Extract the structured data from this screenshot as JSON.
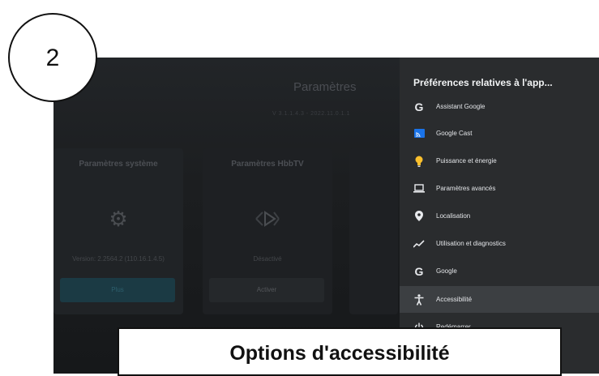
{
  "step_badge": "2",
  "caption": "Options d'accessibilité",
  "background": {
    "title": "Paramètres",
    "version": "V 3.1.1.4.3 - 2022.11.0.1.1",
    "cards": [
      {
        "title": "Paramètres système",
        "icon": "gear-icon",
        "subtitle": "Version: 2.2564.2 (110.16.1.4.5)",
        "button": "Plus"
      },
      {
        "title": "Paramètres HbbTV",
        "icon": "play-icon",
        "subtitle": "Désactivé",
        "button": "Activer"
      }
    ]
  },
  "panel": {
    "title": "Préférences relatives à l'app...",
    "items": [
      {
        "label": "Assistant Google",
        "icon": "google-g-icon"
      },
      {
        "label": "Google Cast",
        "icon": "cast-icon"
      },
      {
        "label": "Puissance et énergie",
        "icon": "lightbulb-icon"
      },
      {
        "label": "Paramètres avancés",
        "icon": "laptop-icon"
      },
      {
        "label": "Localisation",
        "icon": "location-pin-icon"
      },
      {
        "label": "Utilisation et diagnostics",
        "icon": "trend-icon"
      },
      {
        "label": "Google",
        "icon": "google-g-icon"
      },
      {
        "label": "Accessibilité",
        "icon": "accessibility-icon",
        "selected": true
      },
      {
        "label": "Redémarrer",
        "icon": "power-icon"
      }
    ]
  },
  "colors": {
    "panel_bg": "#2a2c2e",
    "selected_bg": "#3c3f42",
    "cast_blue": "#1a73e8",
    "bulb_yellow": "#fbc02d"
  }
}
